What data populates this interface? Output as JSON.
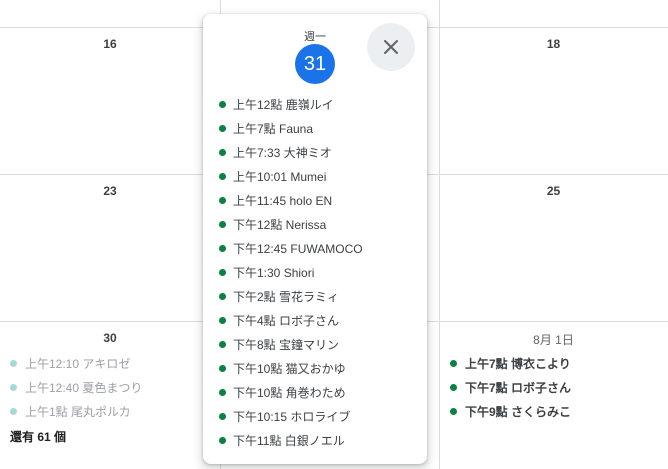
{
  "calendar": {
    "days": {
      "d16": "16",
      "d18": "18",
      "d23": "23",
      "d25": "25",
      "d30": "30",
      "aug1": "8月 1日"
    },
    "day30_events": [
      {
        "time": "上午12:10",
        "title": "アキロゼ"
      },
      {
        "time": "上午12:40",
        "title": "夏色まつり"
      },
      {
        "time": "上午1點",
        "title": "尾丸ポルカ"
      }
    ],
    "day30_more": "還有 61 個",
    "aug1_events": [
      {
        "time": "上午7點",
        "title": "博衣こより"
      },
      {
        "time": "下午7點",
        "title": "ロボ子さん"
      },
      {
        "time": "下午9點",
        "title": "さくらみこ"
      }
    ]
  },
  "popup": {
    "weekday": "週一",
    "date": "31",
    "close_icon": "close-icon",
    "events": [
      {
        "label": "上午12點 鹿嶺ルイ"
      },
      {
        "label": "上午7點 Fauna"
      },
      {
        "label": "上午7:33 大神ミオ"
      },
      {
        "label": "上午10:01 Mumei"
      },
      {
        "label": "上午11:45 holo EN"
      },
      {
        "label": "下午12點 Nerissa"
      },
      {
        "label": "下午12:45 FUWAMOCO"
      },
      {
        "label": "下午1:30 Shiori"
      },
      {
        "label": "下午2點 雪花ラミィ"
      },
      {
        "label": "下午4點 ロボ子さん"
      },
      {
        "label": "下午8點 宝鐘マリン"
      },
      {
        "label": "下午10點 猫又おかゆ"
      },
      {
        "label": "下午10點 角巻わため"
      },
      {
        "label": "下午10:15 ホロライブ"
      },
      {
        "label": "下午11點 白銀ノエル"
      }
    ]
  },
  "colors": {
    "accent": "#1a73e8",
    "event_dot": "#0b8043",
    "event_dot_faded": "#a8d9d3"
  }
}
